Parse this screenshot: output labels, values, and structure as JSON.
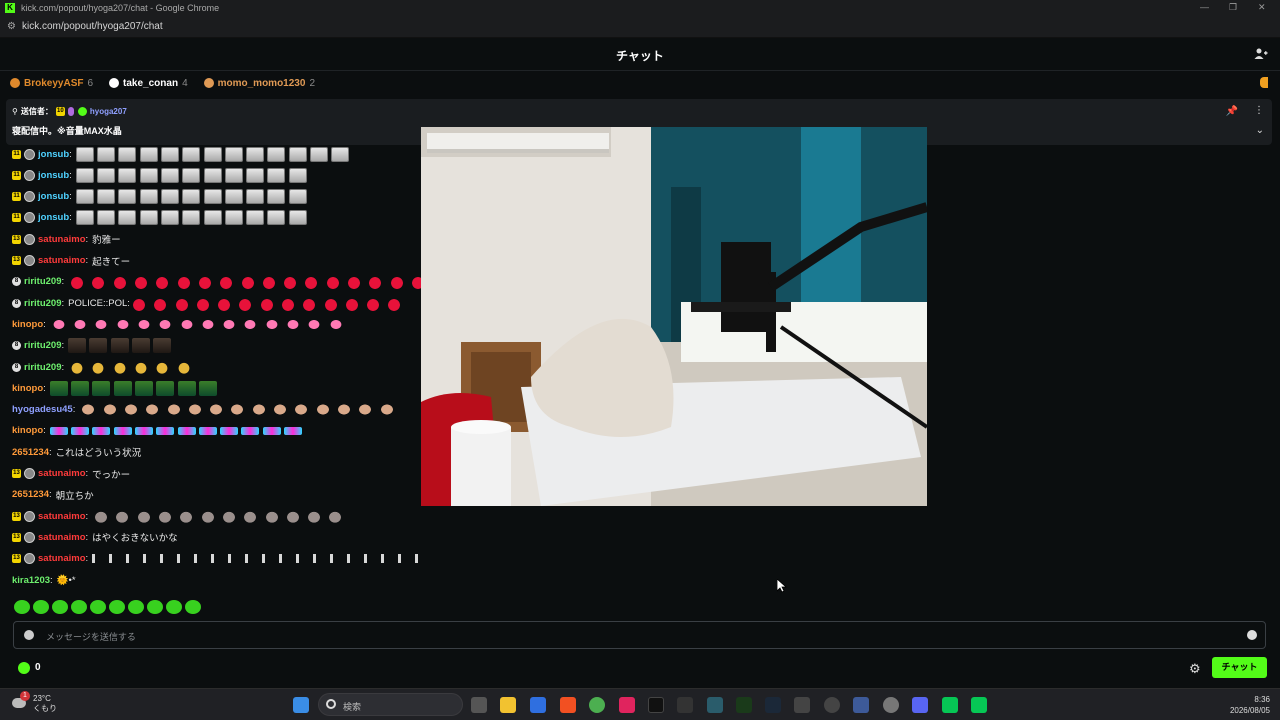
{
  "browser": {
    "window_title": "kick.com/popout/hyoga207/chat - Google Chrome",
    "url": "kick.com/popout/hyoga207/chat",
    "logo_letter": "K",
    "minimize": "—",
    "restore": "❐",
    "close": "✕"
  },
  "header": {
    "title": "チャット"
  },
  "gifters": [
    {
      "name": "BrokeyyASF",
      "count": "6",
      "color": "#e08a2c"
    },
    {
      "name": "take_conan",
      "count": "4",
      "color": "#ffffff"
    },
    {
      "name": "momo_momo1230",
      "count": "2",
      "color": "#e09a55"
    }
  ],
  "pinned": {
    "sender_label": "送信者：",
    "badge": "10",
    "sender": "hyoga207",
    "text": "寝配信中。※音量MAX水晶"
  },
  "messages": [
    {
      "badge": "11",
      "user": "jonsub",
      "color": "#4fd1ff",
      "text": "",
      "emote": "face",
      "n": 13
    },
    {
      "badge": "11",
      "user": "jonsub",
      "color": "#4fd1ff",
      "text": "",
      "emote": "face",
      "n": 11
    },
    {
      "badge": "11",
      "user": "jonsub",
      "color": "#4fd1ff",
      "text": "",
      "emote": "face",
      "n": 11
    },
    {
      "badge": "11",
      "user": "jonsub",
      "color": "#4fd1ff",
      "text": "",
      "emote": "face",
      "n": 11
    },
    {
      "badge": "13",
      "user": "satunaimo",
      "color": "#ff3b3b",
      "text": "豹雅ー",
      "emote": "",
      "n": 0
    },
    {
      "badge": "13",
      "user": "satunaimo",
      "color": "#ff3b3b",
      "text": "起きてー",
      "emote": "",
      "n": 0
    },
    {
      "badge": "8",
      "user": "riritu209",
      "color": "#6ef06e",
      "text": "",
      "emote": "red",
      "n": 17
    },
    {
      "badge": "8",
      "user": "riritu209",
      "color": "#6ef06e",
      "text": "POLICE::POL:",
      "emote": "red",
      "n": 13
    },
    {
      "badge": "",
      "user": "kinopo",
      "color": "#ff9a3a",
      "text": "",
      "emote": "pink",
      "n": 14
    },
    {
      "badge": "8",
      "user": "riritu209",
      "color": "#6ef06e",
      "text": "",
      "emote": "dark",
      "n": 5
    },
    {
      "badge": "8",
      "user": "riritu209",
      "color": "#6ef06e",
      "text": "",
      "emote": "gold",
      "n": 6
    },
    {
      "badge": "",
      "user": "kinopo",
      "color": "#ff9a3a",
      "text": "",
      "emote": "green",
      "n": 8
    },
    {
      "badge": "",
      "user": "hyogadesu45",
      "color": "#8fa0ff",
      "text": "",
      "emote": "skin",
      "n": 15
    },
    {
      "badge": "",
      "user": "kinopo",
      "color": "#ff9a3a",
      "text": "",
      "emote": "multi",
      "n": 12
    },
    {
      "badge": "",
      "user": "2651234",
      "color": "#ff9a3a",
      "text": "これはどういう状況",
      "emote": "",
      "n": 0
    },
    {
      "badge": "13",
      "user": "satunaimo",
      "color": "#ff3b3b",
      "text": "でっかー",
      "emote": "",
      "n": 0
    },
    {
      "badge": "",
      "user": "2651234",
      "color": "#ff9a3a",
      "text": "朝立ちか",
      "emote": "",
      "n": 0
    },
    {
      "badge": "13",
      "user": "satunaimo",
      "color": "#ff3b3b",
      "text": "",
      "emote": "grey",
      "n": 12
    },
    {
      "badge": "13",
      "user": "satunaimo",
      "color": "#ff3b3b",
      "text": "はやくおきないかな",
      "emote": "",
      "n": 0
    },
    {
      "badge": "13",
      "user": "satunaimo",
      "color": "#ff3b3b",
      "text": "",
      "emote": "bars",
      "n": 20
    },
    {
      "badge": "",
      "user": "kira1203",
      "color": "#6ef06e",
      "text": "🌞•*",
      "emote": "",
      "n": 0
    }
  ],
  "input": {
    "placeholder": "メッセージを送信する"
  },
  "footer": {
    "points": "0",
    "send_label": "チャット"
  },
  "taskbar": {
    "temp": "23°C",
    "weather": "くもり",
    "notify": "1",
    "search": "検索",
    "time": "8:36",
    "date": "2026/08/05"
  }
}
